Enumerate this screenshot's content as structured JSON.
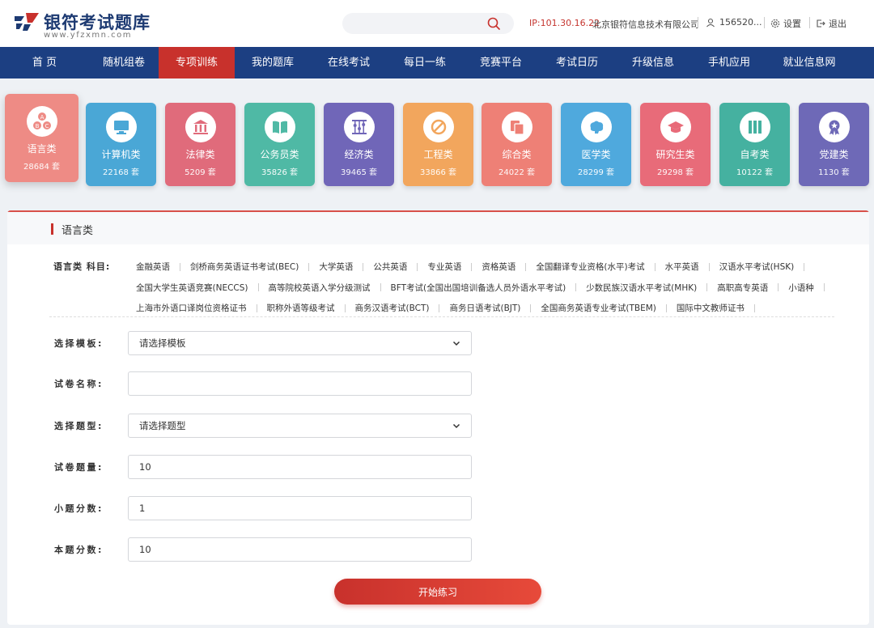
{
  "header": {
    "logo_title": "银符考试题库",
    "logo_url": "www.yfzxmn.com",
    "search_placeholder": "",
    "ip": "IP:101.30.16.22",
    "company": "北京银符信息技术有限公司",
    "user": "156520...",
    "settings": "设置",
    "logout": "退出"
  },
  "nav": {
    "items": [
      "首 页",
      "随机组卷",
      "专项训练",
      "我的题库",
      "在线考试",
      "每日一练",
      "竞赛平台",
      "考试日历",
      "升级信息",
      "手机应用",
      "就业信息网"
    ],
    "active_index": 2
  },
  "categories": [
    {
      "name": "语言类",
      "count": "28684 套",
      "color": "#ee8b85",
      "icon": "abc-icon"
    },
    {
      "name": "计算机类",
      "count": "22168 套",
      "color": "#4aa7d6",
      "icon": "monitor-icon"
    },
    {
      "name": "法律类",
      "count": "5209 套",
      "color": "#e06b7b",
      "icon": "courthouse-icon"
    },
    {
      "name": "公务员类",
      "count": "35826 套",
      "color": "#4fb9a5",
      "icon": "book-icon"
    },
    {
      "name": "经济类",
      "count": "39465 套",
      "color": "#7066b8",
      "icon": "abacus-icon"
    },
    {
      "name": "工程类",
      "count": "33866 套",
      "color": "#f2a65d",
      "icon": "triangle-ruler-icon"
    },
    {
      "name": "综合类",
      "count": "24022 套",
      "color": "#ee8076",
      "icon": "documents-icon"
    },
    {
      "name": "医学类",
      "count": "28299 套",
      "color": "#4fa9dd",
      "icon": "brain-icon"
    },
    {
      "name": "研究生类",
      "count": "29298 套",
      "color": "#e86b79",
      "icon": "graduation-cap-icon"
    },
    {
      "name": "自考类",
      "count": "10122 套",
      "color": "#45b1a0",
      "icon": "books-icon"
    },
    {
      "name": "党建类",
      "count": "1130 套",
      "color": "#6e69b7",
      "icon": "medal-icon"
    }
  ],
  "panel": {
    "title": "语言类",
    "subject_label": "语言类 科目:",
    "subject_lines": [
      [
        "金融英语",
        "剑桥商务英语证书考试(BEC)",
        "大学英语",
        "公共英语",
        "专业英语",
        "资格英语",
        "全国翻译专业资格(水平)考试",
        "水平英语",
        "汉语水平考试(HSK)"
      ],
      [
        "全国大学生英语竞赛(NECCS)",
        "高等院校英语入学分级测试",
        "BFT考试(全国出国培训备选人员外语水平考试)",
        "少数民族汉语水平考试(MHK)",
        "高职高专英语",
        "小语种"
      ],
      [
        "上海市外语口译岗位资格证书",
        "职称外语等级考试",
        "商务汉语考试(BCT)",
        "商务日语考试(BJT)",
        "全国商务英语专业考试(TBEM)",
        "国际中文教师证书"
      ]
    ]
  },
  "form": {
    "template_label": "选择模板:",
    "template_value": "请选择模板",
    "name_label": "试卷名称:",
    "name_value": "",
    "type_label": "选择题型:",
    "type_value": "请选择题型",
    "count_label": "试卷题量:",
    "count_value": "10",
    "small_score_label": "小题分数:",
    "small_score_value": "1",
    "total_score_label": "本题分数:",
    "total_score_value": "10",
    "start_label": "开始练习"
  },
  "colors": {
    "brand_blue": "#1c3f82",
    "accent_red": "#c8312c"
  }
}
